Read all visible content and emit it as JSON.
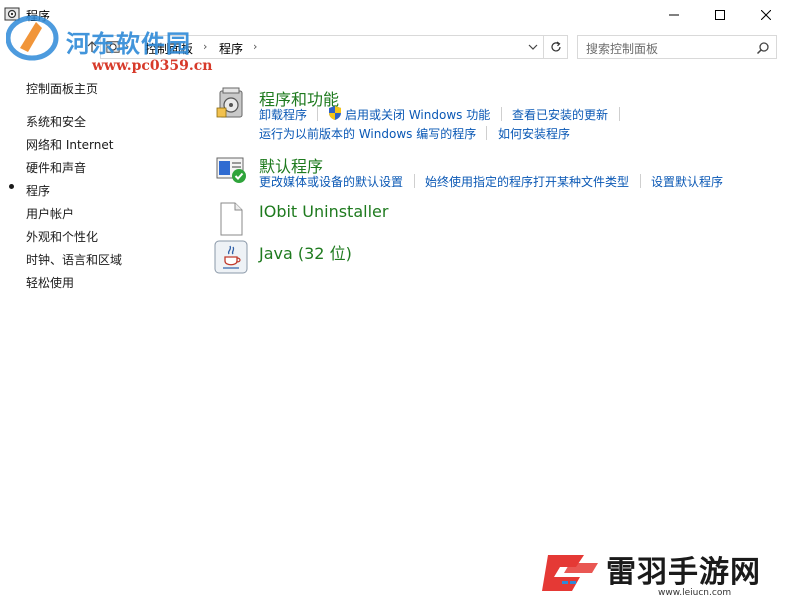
{
  "window": {
    "title": "程序",
    "controls": {
      "minimize": "minimize-icon",
      "maximize": "maximize-icon",
      "close": "close-icon"
    }
  },
  "watermark_top": {
    "title": "河东软件园",
    "url": "www.pc0359.cn"
  },
  "address_bar": {
    "breadcrumbs": [
      "控制面板",
      "程序"
    ],
    "search_placeholder": "搜索控制面板"
  },
  "sidebar": {
    "items": [
      {
        "label": "控制面板主页",
        "active": false
      },
      {
        "label": "系统和安全",
        "active": false
      },
      {
        "label": "网络和 Internet",
        "active": false
      },
      {
        "label": "硬件和声音",
        "active": false
      },
      {
        "label": "程序",
        "active": true
      },
      {
        "label": "用户帐户",
        "active": false
      },
      {
        "label": "外观和个性化",
        "active": false
      },
      {
        "label": "时钟、语言和区域",
        "active": false
      },
      {
        "label": "轻松使用",
        "active": false
      }
    ]
  },
  "main": {
    "categories": [
      {
        "title": "程序和功能",
        "icon": "programs-features-icon",
        "links_row1": [
          "卸载程序",
          "启用或关闭 Windows 功能",
          "查看已安装的更新"
        ],
        "links_row2": [
          "运行为以前版本的 Windows 编写的程序",
          "如何安装程序"
        ]
      },
      {
        "title": "默认程序",
        "icon": "default-programs-icon",
        "links_row1": [
          "更改媒体或设备的默认设置",
          "始终使用指定的程序打开某种文件类型",
          "设置默认程序"
        ]
      },
      {
        "title": "IObit Uninstaller",
        "icon": "blank-file-icon"
      },
      {
        "title": "Java (32 位)",
        "icon": "java-icon"
      }
    ]
  },
  "watermark_bottom": {
    "title": "雷羽手游网",
    "url": "www.leiucn.com"
  },
  "colors": {
    "category_title": "#1e7a1e",
    "link": "#0a58b5",
    "watermark_blue": "#2e8ad8",
    "watermark_red": "#e53935"
  }
}
